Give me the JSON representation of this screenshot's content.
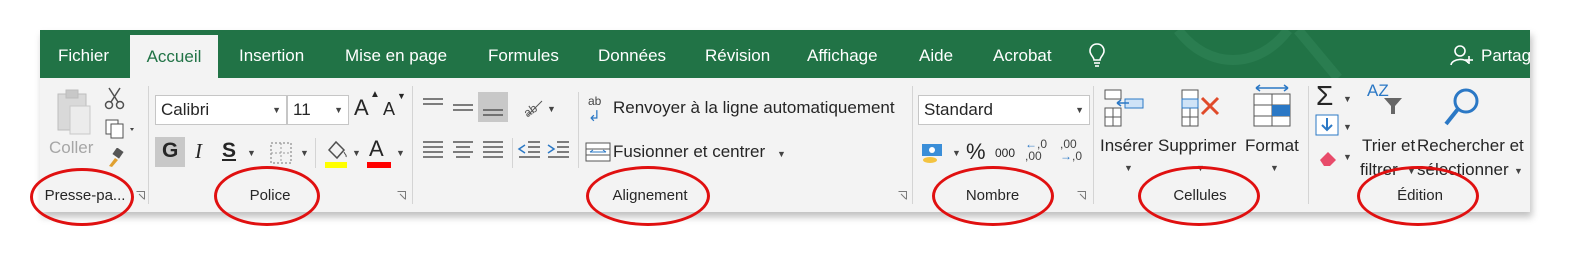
{
  "tabs": [
    {
      "label": "Fichier"
    },
    {
      "label": "Accueil"
    },
    {
      "label": "Insertion"
    },
    {
      "label": "Mise en page"
    },
    {
      "label": "Formules"
    },
    {
      "label": "Données"
    },
    {
      "label": "Révision"
    },
    {
      "label": "Affichage"
    },
    {
      "label": "Aide"
    },
    {
      "label": "Acrobat"
    }
  ],
  "share_label": "Partag",
  "clipboard": {
    "paste_label": "Coller",
    "group_label": "Presse-pa..."
  },
  "font": {
    "name": "Calibri",
    "size": "11",
    "bold_label": "G",
    "italic_label": "I",
    "underline_label": "S",
    "grow_label": "A",
    "shrink_label": "A",
    "color_label": "A",
    "group_label": "Police",
    "highlight_color": "#ffff00",
    "font_color": "#ff0000"
  },
  "alignment": {
    "wrap_icon_label": "ab",
    "wrap_label": "Renvoyer à la ligne automatiquement",
    "merge_label": "Fusionner et centrer",
    "group_label": "Alignement"
  },
  "number": {
    "format": "Standard",
    "percent_label": "%",
    "thousands_label": "000",
    "group_label": "Nombre"
  },
  "cells": {
    "insert_label": "Insérer",
    "delete_label": "Supprimer",
    "format_label": "Format",
    "group_label": "Cellules"
  },
  "editing": {
    "sum_label": "Σ",
    "sort_line1": "Trier et",
    "sort_line2": "filtrer",
    "sort_az": "AZ",
    "find_line1": "Rechercher et",
    "find_line2": "sélectionner",
    "group_label": "Édition"
  },
  "colors": {
    "tab_bar": "#217346",
    "ribbon": "#f3f3f3",
    "annotation": "#e01010"
  }
}
